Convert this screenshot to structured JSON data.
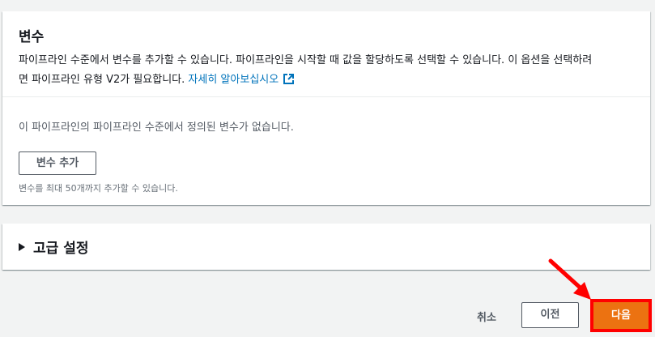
{
  "variables_card": {
    "title": "변수",
    "description_line1": "파이프라인 수준에서 변수를 추가할 수 있습니다. 파이프라인을 시작할 때 값을 할당하도록 선택할 수 있습니다. 이 옵션을 선택하려",
    "description_line2": "면 파이프라인 유형 V2가 필요합니다.",
    "learn_more_link": "자세히 알아보십시오",
    "empty_message": "이 파이프라인의 파이프라인 수준에서 정의된 변수가 없습니다.",
    "add_button": "변수 추가",
    "limit_hint": "변수를 최대 50개까지 추가할 수 있습니다."
  },
  "advanced_card": {
    "title": "고급 설정"
  },
  "footer": {
    "cancel": "취소",
    "previous": "이전",
    "next": "다음"
  },
  "colors": {
    "primary_button": "#ec7211",
    "link": "#0073bb",
    "highlight": "#ff0000"
  },
  "icons": {
    "external_link": "external-link-icon",
    "caret": "caret-right-icon",
    "annotation_arrow": "annotation-arrow-icon"
  }
}
